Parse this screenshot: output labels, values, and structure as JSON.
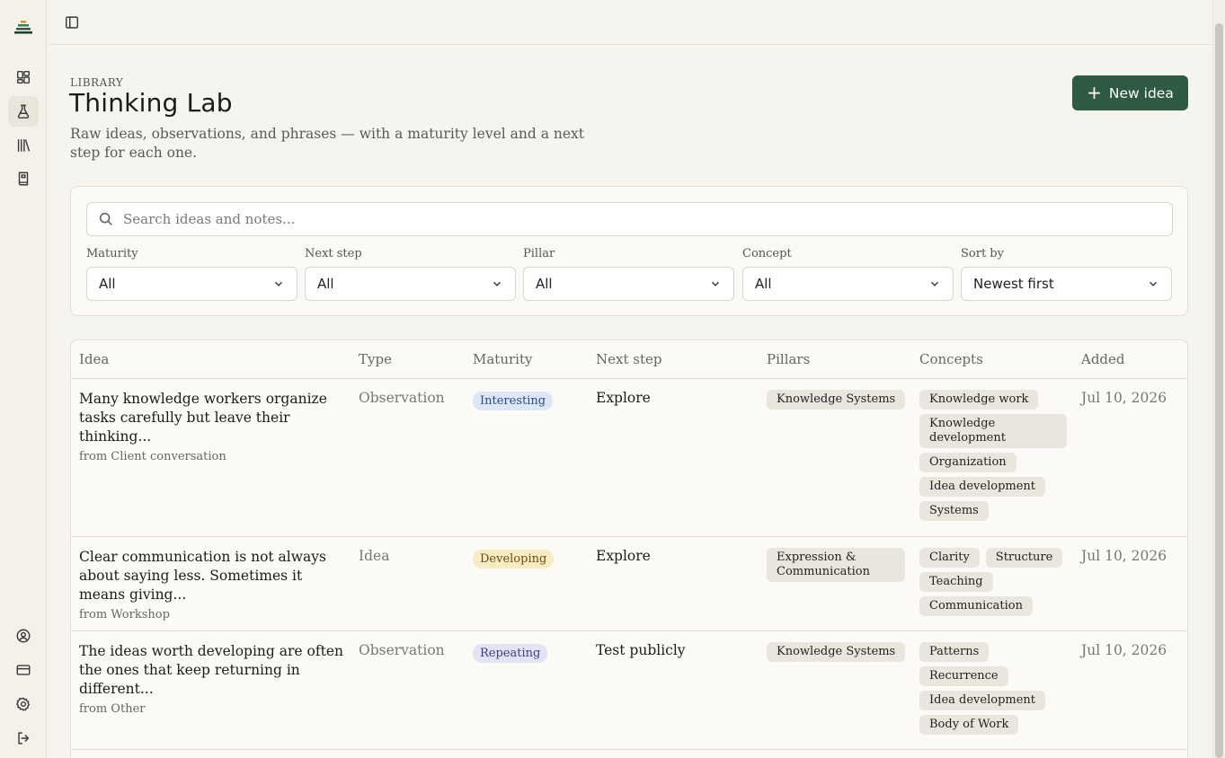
{
  "sidebar": {
    "logo": "stack-logo",
    "nav": [
      "dashboard-icon",
      "flask-icon",
      "library-icon",
      "book-icon"
    ],
    "bottom": [
      "account-icon",
      "card-icon",
      "settings-icon",
      "logout-icon"
    ]
  },
  "header": {
    "eyebrow": "LIBRARY",
    "title": "Thinking Lab",
    "subtitle": "Raw ideas, observations, and phrases — with a maturity level and a next step for each one.",
    "new_button": "New idea"
  },
  "search": {
    "placeholder": "Search ideas and notes..."
  },
  "filters": [
    {
      "label": "Maturity",
      "value": "All"
    },
    {
      "label": "Next step",
      "value": "All"
    },
    {
      "label": "Pillar",
      "value": "All"
    },
    {
      "label": "Concept",
      "value": "All"
    },
    {
      "label": "Sort by",
      "value": "Newest first"
    }
  ],
  "table": {
    "columns": [
      "Idea",
      "Type",
      "Maturity",
      "Next step",
      "Pillars",
      "Concepts",
      "Added"
    ],
    "rows": [
      {
        "idea": "Many knowledge workers organize tasks carefully but leave their thinking...",
        "source": "from Client conversation",
        "type": "Observation",
        "maturity": "Interesting",
        "next_step": "Explore",
        "pillars": [
          "Knowledge Systems"
        ],
        "concepts": [
          "Knowledge work",
          "Knowledge development",
          "Organization",
          "Idea development",
          "Systems"
        ],
        "added": "Jul 10, 2026"
      },
      {
        "idea": "Clear communication is not always about saying less. Sometimes it means giving...",
        "source": "from Workshop",
        "type": "Idea",
        "maturity": "Developing",
        "next_step": "Explore",
        "pillars": [
          "Expression & Communication"
        ],
        "concepts": [
          "Clarity",
          "Structure",
          "Teaching",
          "Communication"
        ],
        "added": "Jul 10, 2026"
      },
      {
        "idea": "The ideas worth developing are often the ones that keep returning in different...",
        "source": "from Other",
        "type": "Observation",
        "maturity": "Repeating",
        "next_step": "Test publicly",
        "pillars": [
          "Knowledge Systems"
        ],
        "concepts": [
          "Patterns",
          "Recurrence",
          "Idea development",
          "Body of Work"
        ],
        "added": "Jul 10, 2026"
      }
    ]
  },
  "colors": {
    "accent": "#2e5a41",
    "interesting_bg": "#dce6f7",
    "interesting_fg": "#2b4a86",
    "developing_bg": "#f8ecc4",
    "developing_fg": "#6b4a12",
    "repeating_bg": "#e4e3f5",
    "repeating_fg": "#3a3c84"
  }
}
